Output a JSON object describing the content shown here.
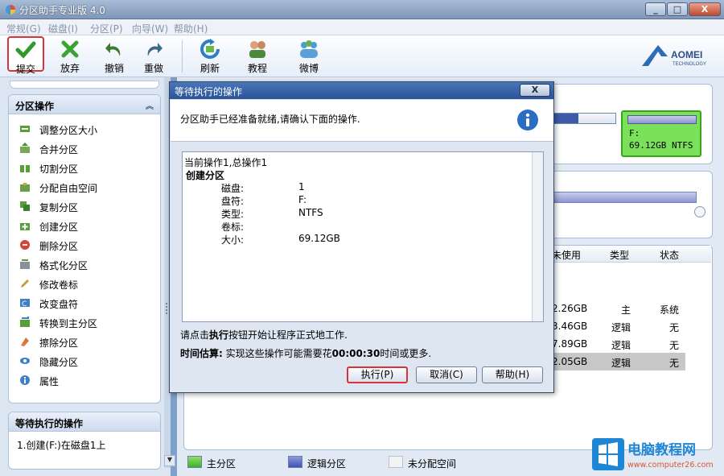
{
  "window": {
    "title": "分区助手专业版 4.0",
    "controls": {
      "minimize": "_",
      "maximize": "□",
      "close": "X"
    }
  },
  "menu": [
    "常规(G)",
    "磁盘(I)",
    "分区(P)",
    "向导(W)",
    "帮助(H)"
  ],
  "toolbar": {
    "items": [
      {
        "label": "提交",
        "icon": "check-icon",
        "color": "#2f9a2b"
      },
      {
        "label": "放弃",
        "icon": "x-icon",
        "color": "#3aa62f"
      },
      {
        "label": "撤销",
        "icon": "undo-icon",
        "color": "#3d7a2e"
      },
      {
        "label": "重做",
        "icon": "redo-icon",
        "color": "#3d6a88"
      },
      {
        "label": "刷新",
        "icon": "refresh-icon",
        "color": "#2f7cc8"
      },
      {
        "label": "教程",
        "icon": "users-icon",
        "color": "#4a8a3a"
      },
      {
        "label": "微博",
        "icon": "people-icon",
        "color": "#4f9bd0"
      }
    ],
    "logo": {
      "text": "AOMEI",
      "sub": "TECHNOLOGY"
    }
  },
  "left_panel": {
    "operations": {
      "title": "分区操作",
      "collapse": "︽",
      "items": [
        {
          "label": "调整分区大小",
          "icon": "resize-partition-icon"
        },
        {
          "label": "合并分区",
          "icon": "merge-partition-icon"
        },
        {
          "label": "切割分区",
          "icon": "split-partition-icon"
        },
        {
          "label": "分配自由空间",
          "icon": "allocate-space-icon"
        },
        {
          "label": "复制分区",
          "icon": "copy-partition-icon"
        },
        {
          "label": "创建分区",
          "icon": "create-partition-icon"
        },
        {
          "label": "删除分区",
          "icon": "delete-partition-icon"
        },
        {
          "label": "格式化分区",
          "icon": "format-partition-icon"
        },
        {
          "label": "修改卷标",
          "icon": "edit-label-icon"
        },
        {
          "label": "改变盘符",
          "icon": "change-letter-icon"
        },
        {
          "label": "转换到主分区",
          "icon": "convert-primary-icon"
        },
        {
          "label": "擦除分区",
          "icon": "wipe-partition-icon"
        },
        {
          "label": "隐藏分区",
          "icon": "hide-partition-icon"
        },
        {
          "label": "属性",
          "icon": "properties-icon"
        }
      ]
    },
    "pending": {
      "title": "等待执行的操作",
      "items": [
        "1.创建(F:)在磁盘1上"
      ]
    }
  },
  "right_panel": {
    "f_partition": {
      "line1": "F:",
      "line2": "69.12GB NTFS"
    },
    "table_headers": [
      "未使用",
      "类型",
      "状态"
    ],
    "rows": [
      {
        "unused": "2.26GB",
        "type": "主",
        "status": "系统"
      },
      {
        "unused": "3.46GB",
        "type": "逻辑",
        "status": "无"
      },
      {
        "unused": "7.89GB",
        "type": "逻辑",
        "status": "无"
      },
      {
        "unused": "2.05GB",
        "type": "逻辑",
        "status": "无"
      }
    ],
    "legend": [
      {
        "label": "主分区",
        "color": "#4cc23a"
      },
      {
        "label": "逻辑分区",
        "color": "#4b63c4"
      },
      {
        "label": "未分配空间",
        "color": "#f2f2f2"
      }
    ]
  },
  "dialog": {
    "title": "等待执行的操作",
    "close": "X",
    "message": "分区助手已经准备就绪,请确认下面的操作.",
    "info_icon": "info-icon",
    "ops": {
      "summary": "当前操作1,总操作1",
      "heading": "创建分区",
      "fields": [
        {
          "key": "磁盘:",
          "value": "1"
        },
        {
          "key": "盘符:",
          "value": "F:"
        },
        {
          "key": "类型:",
          "value": "NTFS"
        },
        {
          "key": "卷标:",
          "value": ""
        },
        {
          "key": "大小:",
          "value": "69.12GB"
        }
      ]
    },
    "note_pre": "请点击",
    "note_bold": "执行",
    "note_post": "按钮开始让程序正式地工作.",
    "time_label": "时间估算:",
    "time_pre": " 实现这些操作可能需要花",
    "time_value": "00:00:30",
    "time_post": "时间或更多.",
    "buttons": {
      "execute": "执行(P)",
      "cancel": "取消(C)",
      "help": "帮助(H)"
    }
  },
  "brand": {
    "text": "电脑教程网",
    "url": "www.computer26.com"
  }
}
